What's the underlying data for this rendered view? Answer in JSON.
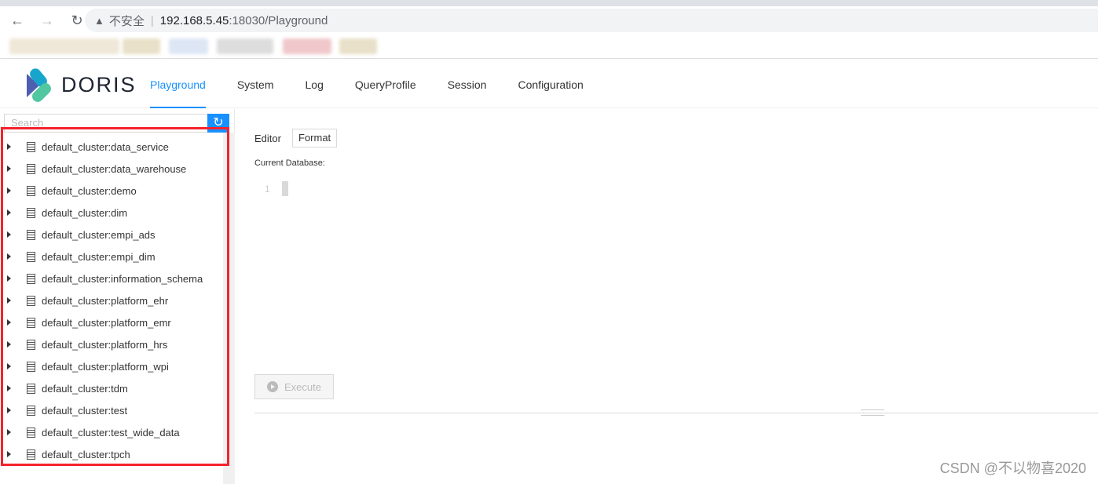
{
  "browser": {
    "insecure_label": "不安全",
    "url_host": "192.168.5.45",
    "url_rest": ":18030/Playground"
  },
  "header": {
    "logo": "DORIS",
    "nav": [
      {
        "label": "Playground",
        "active": true
      },
      {
        "label": "System"
      },
      {
        "label": "Log"
      },
      {
        "label": "QueryProfile"
      },
      {
        "label": "Session"
      },
      {
        "label": "Configuration"
      }
    ]
  },
  "sidebar": {
    "search_placeholder": "Search",
    "databases": [
      "default_cluster:data_service",
      "default_cluster:data_warehouse",
      "default_cluster:demo",
      "default_cluster:dim",
      "default_cluster:empi_ads",
      "default_cluster:empi_dim",
      "default_cluster:information_schema",
      "default_cluster:platform_ehr",
      "default_cluster:platform_emr",
      "default_cluster:platform_hrs",
      "default_cluster:platform_wpi",
      "default_cluster:tdm",
      "default_cluster:test",
      "default_cluster:test_wide_data",
      "default_cluster:tpch"
    ]
  },
  "editor": {
    "label": "Editor",
    "format_label": "Format",
    "current_db_label": "Current Database:",
    "line_number": "1",
    "execute_label": "Execute"
  },
  "watermark": "CSDN @不以物喜2020",
  "colors": {
    "accent": "#1890ff",
    "highlight_box": "#f5222d"
  }
}
